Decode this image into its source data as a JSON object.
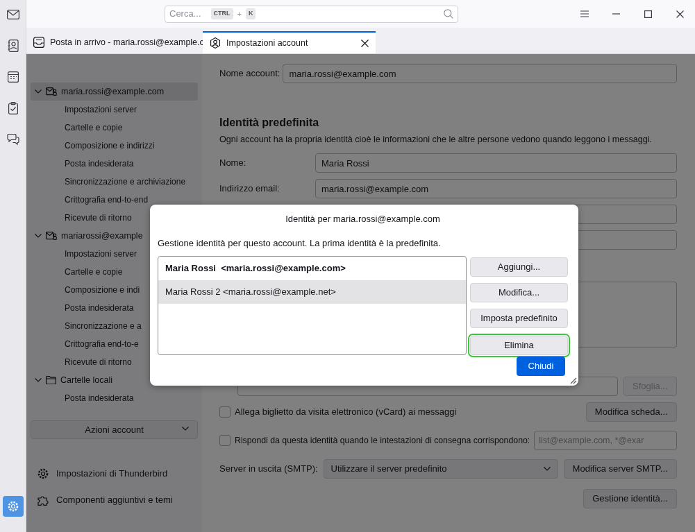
{
  "search": {
    "placeholder": "Cerca...",
    "keys": [
      "CTRL",
      "K"
    ],
    "joiner": "+"
  },
  "spaces": [
    {
      "kind": "mail",
      "selected": false
    },
    {
      "kind": "contacts",
      "selected": false
    },
    {
      "kind": "calendar",
      "selected": false
    },
    {
      "kind": "tasks",
      "selected": false
    },
    {
      "kind": "chat",
      "selected": false
    },
    {
      "kind": "settings",
      "selected": true
    }
  ],
  "tabs": [
    {
      "kind": "inbox",
      "label": "Posta in arrivo - maria.rossi@example.c",
      "selected": false
    },
    {
      "kind": "account",
      "label": "Impostazioni account",
      "selected": true
    }
  ],
  "account_tree": [
    {
      "kind": "account",
      "label": "maria.rossi@example.com",
      "expanded": true,
      "selected": true,
      "children": [
        {
          "label": "Impostazioni server"
        },
        {
          "label": "Cartelle e copie"
        },
        {
          "label": "Composizione e indirizzi"
        },
        {
          "label": "Posta indesiderata"
        },
        {
          "label": "Sincronizzazione e archiviazione"
        },
        {
          "label": "Crittografia end-to-end"
        },
        {
          "label": "Ricevute di ritorno"
        }
      ]
    },
    {
      "kind": "account",
      "label": "mariarossi@example",
      "expanded": true,
      "selected": false,
      "children": [
        {
          "label": "Impostazioni server"
        },
        {
          "label": "Cartelle e copie"
        },
        {
          "label": "Composizione e indi"
        },
        {
          "label": "Posta indesiderata"
        },
        {
          "label": "Sincronizzazione e a"
        },
        {
          "label": "Crittografia end-to-e"
        },
        {
          "label": "Ricevute di ritorno"
        }
      ]
    },
    {
      "kind": "folder",
      "label": "Cartelle locali",
      "expanded": true,
      "selected": false,
      "children": [
        {
          "label": "Posta indesiderata"
        }
      ]
    }
  ],
  "account_actions": "Azioni account",
  "footer_links": [
    {
      "kind": "settings",
      "label": "Impostazioni di Thunderbird"
    },
    {
      "kind": "addons",
      "label": "Componenti aggiuntivi e temi"
    }
  ],
  "settings": {
    "account_name": {
      "label": "Nome account:",
      "value": "maria.rossi@example.com"
    },
    "identity_heading": "Identità predefinita",
    "identity_description": "Ogni account ha la propria identità cioè le informazioni che le altre persone vedono quando leggono i messaggi.",
    "fields": [
      {
        "label": "Nome:",
        "value": "Maria Rossi"
      },
      {
        "label": "Indirizzo email:",
        "value": "maria.rossi@example.com"
      }
    ],
    "browse_button": {
      "label": "Sfoglia...",
      "disabled": true
    },
    "vcard": {
      "label": "Allega biglietto da visita elettronico (vCard) ai messaggi",
      "checked": false,
      "button": "Modifica scheda..."
    },
    "reply_from": {
      "label": "Rispondi da questa identità quando le intestazioni di consegna corrispondono:",
      "checked": false,
      "placeholder": "list@example.com, *@exar"
    },
    "smtp": {
      "label": "Server in uscita (SMTP):",
      "value": "Utilizzare il server predefinito",
      "button": "Modifica server SMTP..."
    },
    "manage_button": "Gestione identità..."
  },
  "dialog": {
    "title": "Identità per maria.rossi@example.com",
    "description": "Gestione identità per questo account. La prima identità è la predefinita.",
    "identities": [
      {
        "label": "Maria Rossi  <maria.rossi@example.com>",
        "default": true,
        "selected": false
      },
      {
        "label": "Maria Rossi 2 <maria.rossi@example.net>",
        "default": false,
        "selected": true
      }
    ],
    "buttons": [
      {
        "label": "Aggiungi...",
        "focused": false
      },
      {
        "label": "Modifica...",
        "focused": false
      },
      {
        "label": "Imposta predefinito",
        "focused": false
      },
      {
        "label": "Elimina",
        "focused": true
      }
    ],
    "close_button": "Chiudi"
  }
}
